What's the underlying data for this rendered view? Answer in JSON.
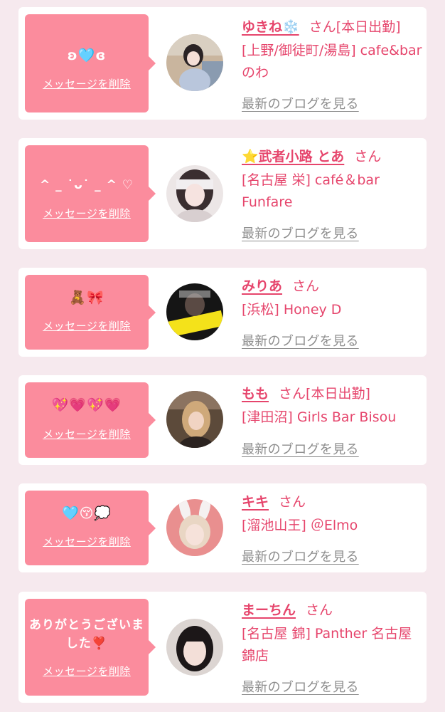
{
  "delete_label": "メッセージを削除",
  "blog_label": "最新のブログを見る",
  "san_label": "さん",
  "colors": {
    "background": "#f6e9ee",
    "bubble": "#fb8c9d",
    "accent_text": "#e6456c",
    "link_gray": "#8d8d8d",
    "card": "#ffffff"
  },
  "entries": [
    {
      "message": "ʚ🩵ɞ",
      "name": "ゆきね❄️",
      "status": "[本日出勤]",
      "shop": "[上野/御徒町/湯島] cafe&bar のわ"
    },
    {
      "message": "^ _ ˙ᴗ˙ _ ^ ♡",
      "name": "⭐️武者小路 とあ",
      "status": "",
      "shop": "[名古屋 栄] café＆bar Funfare"
    },
    {
      "message": "🧸🎀",
      "name": "みりあ",
      "status": "",
      "shop": "[浜松] Honey D"
    },
    {
      "message": "💖💗💖💗",
      "name": "もも",
      "status": "[本日出勤]",
      "shop": "[津田沼] Girls Bar Bisou"
    },
    {
      "message": "🩵😚💭",
      "name": "キキ",
      "status": "",
      "shop": "[溜池山王] ＠Elmo"
    },
    {
      "message": "ありがとうございました❣️",
      "name": "まーちん",
      "status": "",
      "shop": "[名古屋 錦] Panther 名古屋錦店"
    }
  ]
}
